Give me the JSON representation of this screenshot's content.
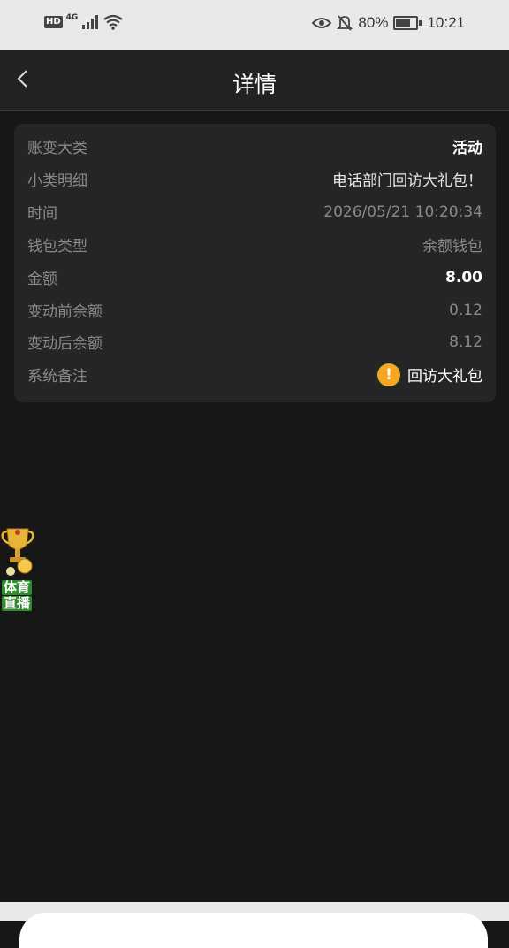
{
  "status_bar": {
    "hd": "HD",
    "network": "4G",
    "battery": "80%",
    "battery_level": 0.8,
    "time": "10:21"
  },
  "nav": {
    "title": "详情"
  },
  "details": {
    "rows": [
      {
        "label": "账变大类",
        "value": "活动"
      },
      {
        "label": "小类明细",
        "value": "电话部门回访大礼包！"
      },
      {
        "label": "时间",
        "value": "2026/05/21 10:20:34"
      },
      {
        "label": "钱包类型",
        "value": "余额钱包"
      },
      {
        "label": "金额",
        "value": "8.00"
      },
      {
        "label": "变动前余额",
        "value": "0.12"
      },
      {
        "label": "变动后余额",
        "value": "8.12"
      },
      {
        "label": "系统备注",
        "value": "回访大礼包"
      }
    ]
  },
  "float_widget": {
    "line1": "体育",
    "line2": "直播"
  },
  "colors": {
    "background": "#171717",
    "card": "#252525",
    "accent_warning": "#f5a623"
  }
}
